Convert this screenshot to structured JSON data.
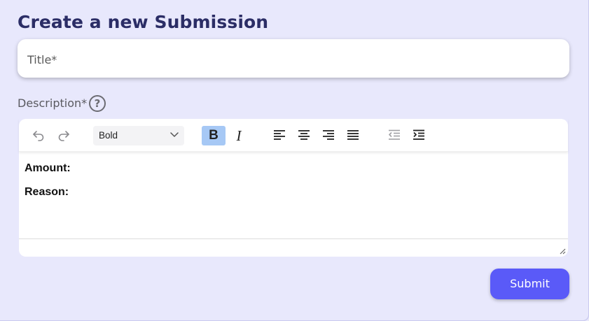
{
  "page": {
    "heading": "Create a new Submission"
  },
  "title_field": {
    "placeholder": "Title*",
    "value": ""
  },
  "description": {
    "label": "Description*",
    "help_glyph": "?"
  },
  "toolbar": {
    "undo_icon": "undo-icon",
    "redo_icon": "redo-icon",
    "block_format": "Bold",
    "bold_label": "B",
    "italic_label": "I",
    "bold_active": true,
    "active_color": "#a6c8f5"
  },
  "editor_content": {
    "lines": [
      "Amount:",
      "Reason:"
    ]
  },
  "submit": {
    "label": "Submit",
    "color": "#5a5af8"
  }
}
